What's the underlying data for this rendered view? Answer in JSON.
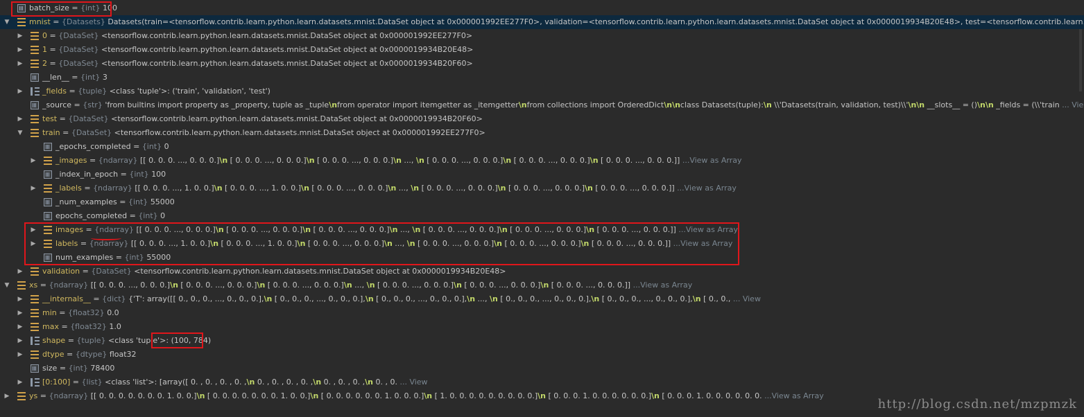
{
  "watermark": "http://blog.csdn.net/mzpmzk",
  "view_labels": {
    "view": "... View",
    "array": "...View as Array"
  },
  "rows": [
    {
      "indent": 0,
      "arrow": "",
      "icon": "field",
      "name": "batch_size",
      "type": "{int}",
      "value": "100",
      "more": ""
    },
    {
      "indent": 0,
      "arrow": "down",
      "icon": "obj",
      "name": "mnist",
      "type": "{Datasets}",
      "value": "Datasets(train=<tensorflow.contrib.learn.python.learn.datasets.mnist.DataSet object at 0x000001992EE277F0>, validation=<tensorflow.contrib.learn.python.learn.datasets.mnist.DataSet object at 0x0000019934B20E48>, test=<tensorflow.contrib.learn.python.learn.",
      "more": "view",
      "selected": true
    },
    {
      "indent": 1,
      "arrow": "right",
      "icon": "obj",
      "name": "0",
      "type": "{DataSet}",
      "value": "<tensorflow.contrib.learn.python.learn.datasets.mnist.DataSet object at 0x000001992EE277F0>",
      "more": ""
    },
    {
      "indent": 1,
      "arrow": "right",
      "icon": "obj",
      "name": "1",
      "type": "{DataSet}",
      "value": "<tensorflow.contrib.learn.python.learn.datasets.mnist.DataSet object at 0x0000019934B20E48>",
      "more": ""
    },
    {
      "indent": 1,
      "arrow": "right",
      "icon": "obj",
      "name": "2",
      "type": "{DataSet}",
      "value": "<tensorflow.contrib.learn.python.learn.datasets.mnist.DataSet object at 0x0000019934B20F60>",
      "more": ""
    },
    {
      "indent": 1,
      "arrow": "",
      "icon": "field",
      "name": "__len__",
      "type": "{int}",
      "value": "3",
      "more": ""
    },
    {
      "indent": 1,
      "arrow": "right",
      "icon": "tuple",
      "name": "_fields",
      "type": "{tuple}",
      "value": "<class 'tuple'>: ('train', 'validation', 'test')",
      "more": ""
    },
    {
      "indent": 1,
      "arrow": "",
      "icon": "field",
      "name": "_source",
      "type": "{str}",
      "value": "'from builtins import property as _property, tuple as _tuple\\nfrom operator import itemgetter as _itemgetter\\nfrom collections import OrderedDict\\n\\nclass Datasets(tuple):\\n    \\\\'Datasets(train, validation, test)\\\\'\\n\\n    __slots__ = ()\\n\\n    _fields = (\\\\'train",
      "more": "view"
    },
    {
      "indent": 1,
      "arrow": "right",
      "icon": "obj",
      "name": "test",
      "type": "{DataSet}",
      "value": "<tensorflow.contrib.learn.python.learn.datasets.mnist.DataSet object at 0x0000019934B20F60>",
      "more": ""
    },
    {
      "indent": 1,
      "arrow": "down",
      "icon": "obj",
      "name": "train",
      "type": "{DataSet}",
      "value": "<tensorflow.contrib.learn.python.learn.datasets.mnist.DataSet object at 0x000001992EE277F0>",
      "more": ""
    },
    {
      "indent": 2,
      "arrow": "",
      "icon": "field",
      "name": "_epochs_completed",
      "type": "{int}",
      "value": "0",
      "more": ""
    },
    {
      "indent": 2,
      "arrow": "right",
      "icon": "obj",
      "name": "_images",
      "type": "{ndarray}",
      "value": "[[ 0.  0.  0. ...,  0.  0.  0.]\\n [ 0.  0.  0. ...,  0.  0.  0.]\\n [ 0.  0.  0. ...,  0.  0.  0.]\\n ..., \\n [ 0.  0.  0. ...,  0.  0.  0.]\\n [ 0.  0.  0. ...,  0.  0.  0.]\\n [ 0.  0.  0. ...,  0.  0.  0.]]",
      "more": "array"
    },
    {
      "indent": 2,
      "arrow": "",
      "icon": "field",
      "name": "_index_in_epoch",
      "type": "{int}",
      "value": "100",
      "more": ""
    },
    {
      "indent": 2,
      "arrow": "right",
      "icon": "obj",
      "name": "_labels",
      "type": "{ndarray}",
      "value": "[[ 0.  0.  0. ...,  1.  0.  0.]\\n [ 0.  0.  0. ...,  1.  0.  0.]\\n [ 0.  0.  0. ...,  0.  0.  0.]\\n ..., \\n [ 0.  0.  0. ...,  0.  0.  0.]\\n [ 0.  0.  0. ...,  0.  0.  0.]\\n [ 0.  0.  0. ...,  0.  0.  0.]]",
      "more": "array"
    },
    {
      "indent": 2,
      "arrow": "",
      "icon": "field",
      "name": "_num_examples",
      "type": "{int}",
      "value": "55000",
      "more": ""
    },
    {
      "indent": 2,
      "arrow": "",
      "icon": "field",
      "name": "epochs_completed",
      "type": "{int}",
      "value": "0",
      "more": ""
    },
    {
      "indent": 2,
      "arrow": "right",
      "icon": "obj",
      "name": "images",
      "type": "{ndarray}",
      "value": "[[ 0.  0.  0. ...,  0.  0.  0.]\\n [ 0.  0.  0. ...,  0.  0.  0.]\\n [ 0.  0.  0. ...,  0.  0.  0.]\\n ..., \\n [ 0.  0.  0. ...,  0.  0.  0.]\\n [ 0.  0.  0. ...,  0.  0.  0.]\\n [ 0.  0.  0. ...,  0.  0.  0.]]",
      "more": "array"
    },
    {
      "indent": 2,
      "arrow": "right",
      "icon": "obj",
      "name": "labels",
      "type": "{ndarray}",
      "value": "[[ 0.  0.  0. ...,  1.  0.  0.]\\n [ 0.  0.  0. ...,  1.  0.  0.]\\n [ 0.  0.  0. ...,  0.  0.  0.]\\n ..., \\n [ 0.  0.  0. ...,  0.  0.  0.]\\n [ 0.  0.  0. ...,  0.  0.  0.]\\n [ 0.  0.  0. ...,  0.  0.  0.]]",
      "more": "array"
    },
    {
      "indent": 2,
      "arrow": "",
      "icon": "field",
      "name": "num_examples",
      "type": "{int}",
      "value": "55000",
      "more": ""
    },
    {
      "indent": 1,
      "arrow": "right",
      "icon": "obj",
      "name": "validation",
      "type": "{DataSet}",
      "value": "<tensorflow.contrib.learn.python.learn.datasets.mnist.DataSet object at 0x0000019934B20E48>",
      "more": ""
    },
    {
      "indent": 0,
      "arrow": "down",
      "icon": "obj",
      "name": "xs",
      "type": "{ndarray}",
      "value": "[[ 0.  0.  0. ...,  0.  0.  0.]\\n [ 0.  0.  0. ...,  0.  0.  0.]\\n [ 0.  0.  0. ...,  0.  0.  0.]\\n ..., \\n [ 0.  0.  0. ...,  0.  0.  0.]\\n [ 0.  0.  0. ...,  0.  0.  0.]\\n [ 0.  0.  0. ...,  0.  0.  0.]]",
      "more": "array"
    },
    {
      "indent": 1,
      "arrow": "right",
      "icon": "obj",
      "name": "__internals__",
      "type": "{dict}",
      "value": "{'T': array([[ 0.,  0.,  0., ...,  0.,  0.,  0.],\\n       [ 0.,  0.,  0., ...,  0.,  0.,  0.],\\n       [ 0.,  0.,  0., ...,  0.,  0.,  0.],\\n       ..., \\n       [ 0.,  0.,  0., ...,  0.,  0.,  0.],\\n       [ 0.,  0.,  0., ...,  0.,  0.,  0.],\\n       [ 0.,  0.,",
      "more": "view"
    },
    {
      "indent": 1,
      "arrow": "right",
      "icon": "obj",
      "name": "min",
      "type": "{float32}",
      "value": "0.0",
      "more": ""
    },
    {
      "indent": 1,
      "arrow": "right",
      "icon": "obj",
      "name": "max",
      "type": "{float32}",
      "value": "1.0",
      "more": ""
    },
    {
      "indent": 1,
      "arrow": "right",
      "icon": "tuple",
      "name": "shape",
      "type": "{tuple}",
      "value": "<class 'tuple'>: (100, 784)",
      "more": ""
    },
    {
      "indent": 1,
      "arrow": "right",
      "icon": "obj",
      "name": "dtype",
      "type": "{dtype}",
      "value": "float32",
      "more": ""
    },
    {
      "indent": 1,
      "arrow": "",
      "icon": "field",
      "name": "size",
      "type": "{int}",
      "value": "78400",
      "more": ""
    },
    {
      "indent": 1,
      "arrow": "right",
      "icon": "tuple",
      "name": "[0:100]",
      "type": "{list}",
      "value": "<class 'list'>: [array([ 0.        ,  0.        ,  0.        ,  0.        ,\\n        0.        ,  0.        ,  0.        ,  0.        ,\\n        0.        ,  0.        ,  0.        ,\\n        0.        ,  0.",
      "more": "view"
    },
    {
      "indent": 0,
      "arrow": "right",
      "icon": "obj",
      "name": "ys",
      "type": "{ndarray}",
      "value": "[[ 0.  0.  0.  0.  0.  0.  0.  1.  0.  0.]\\n [ 0.  0.  0.  0.  0.  0.  0.  1.  0.  0.]\\n [ 0.  0.  0.  0.  0.  0.  1.  0.  0.  0.]\\n [ 1.  0.  0.  0.  0.  0.  0.  0.  0.  0.]\\n [ 0.  0.  0.  1.  0.  0.  0.  0.  0.  0.]\\n [ 0.  0.  0.  1.  0.  0.  0.  0.  0.  0.",
      "more": "array"
    }
  ]
}
